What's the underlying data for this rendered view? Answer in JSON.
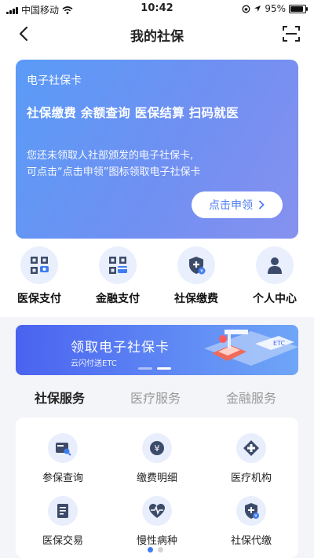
{
  "status_bar": {
    "carrier": "中国移动",
    "time": "10:42",
    "battery": "95%"
  },
  "nav": {
    "title": "我的社保"
  },
  "card": {
    "title": "电子社保卡",
    "features": "社保缴费 余额查询 医保结算 扫码就医",
    "desc_line1": "您还未领取人社部颁发的电子社保卡,",
    "desc_line2": "可点击“点击申领”图标领取电子社保卡",
    "button": "点击申领"
  },
  "quick_actions": [
    {
      "label": "医保支付",
      "icon": "medical-pay-qr-icon"
    },
    {
      "label": "金融支付",
      "icon": "finance-pay-qr-icon"
    },
    {
      "label": "社保缴费",
      "icon": "shield-plus-icon"
    },
    {
      "label": "个人中心",
      "icon": "person-icon"
    }
  ],
  "banner": {
    "title": "领取电子社保卡",
    "subtitle": "云闪付送ETC",
    "art_label": "ETC"
  },
  "tabs": [
    {
      "label": "社保服务",
      "active": true
    },
    {
      "label": "医疗服务",
      "active": false
    },
    {
      "label": "金融服务",
      "active": false
    }
  ],
  "services": [
    {
      "label": "参保查询",
      "icon": "card-search-icon"
    },
    {
      "label": "缴费明细",
      "icon": "yen-icon"
    },
    {
      "label": "医疗机构",
      "icon": "medical-cross-icon"
    },
    {
      "label": "医保交易",
      "icon": "document-icon"
    },
    {
      "label": "慢性病种",
      "icon": "heartbeat-icon"
    },
    {
      "label": "社保代缴",
      "icon": "shield-plus-icon"
    }
  ],
  "colors": {
    "accent": "#3f7cf0",
    "card_gradient_start": "#5a9bf7",
    "card_gradient_end": "#8691ef"
  }
}
